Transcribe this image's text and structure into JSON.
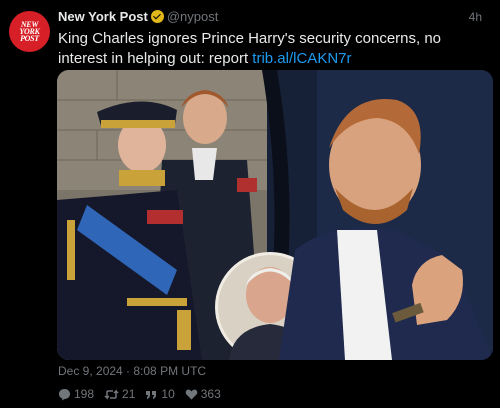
{
  "account": {
    "name": "New York Post",
    "handle": "@nypost",
    "avatar_text": [
      "NEW",
      "YORK",
      "POST"
    ],
    "verified_color": "#e2b719"
  },
  "tweet": {
    "age": "4h",
    "text": "King Charles ignores Prince Harry's security concerns, no interest in helping out: report ",
    "link": "trib.al/lCAKN7r",
    "date": "Dec 9, 2024 · 8:08 PM UTC"
  },
  "stats": {
    "replies": "198",
    "retweets": "21",
    "quotes": "10",
    "likes": "363"
  },
  "colors": {
    "background": "#000000",
    "text": "#e7e9ea",
    "muted": "#71767b",
    "link": "#1d9bf0",
    "brand": "#d61f26"
  }
}
